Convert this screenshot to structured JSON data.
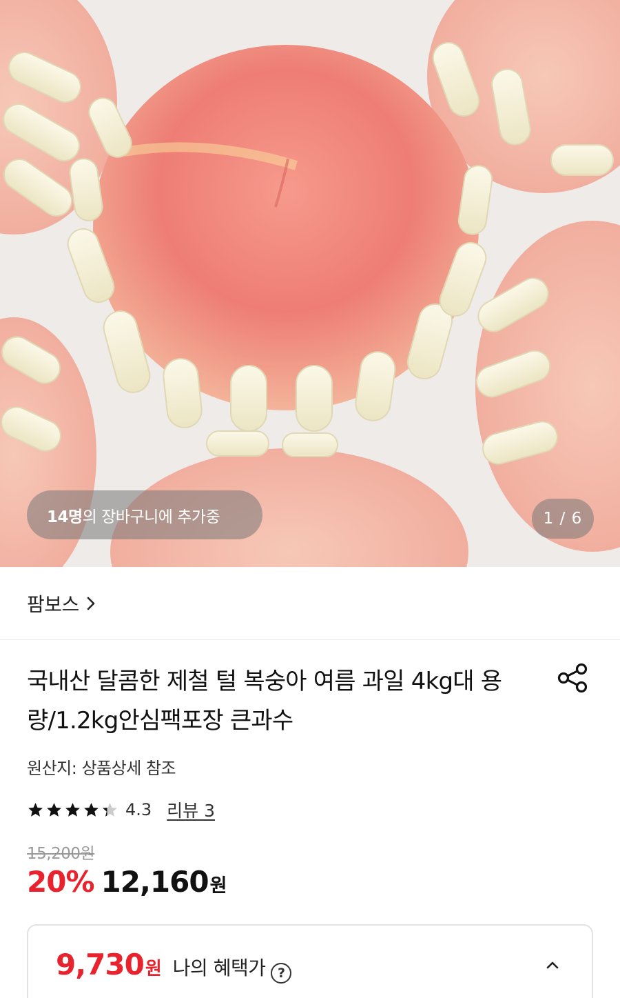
{
  "hero": {
    "cart_count": "14명",
    "cart_text": "의 장바구니에 추가중",
    "page_indicator": "1 / 6"
  },
  "store": {
    "name": "팜보스",
    "chevron_icon": "chevron-right-icon"
  },
  "product": {
    "title": "국내산 달콤한 제철 털 복숭아 여름 과일 4kg대 용량/1.2kg안심팩포장 큰과수",
    "share_icon": "share-icon",
    "origin": "원산지: 상품상세 참조",
    "rating": 4.3,
    "rating_text": "4.3",
    "review_label": "리뷰 3",
    "original_price": "15,200원",
    "discount": "20%",
    "price": "12,160",
    "price_unit": "원"
  },
  "benefit": {
    "price": "9,730",
    "price_unit": "원",
    "label": "나의 혜택가",
    "help_icon": "question-circle-icon",
    "help_glyph": "?",
    "collapse_icon": "chevron-up-icon"
  },
  "colors": {
    "accent_red": "#e8232e",
    "star": "#111111",
    "muted": "#999999"
  }
}
